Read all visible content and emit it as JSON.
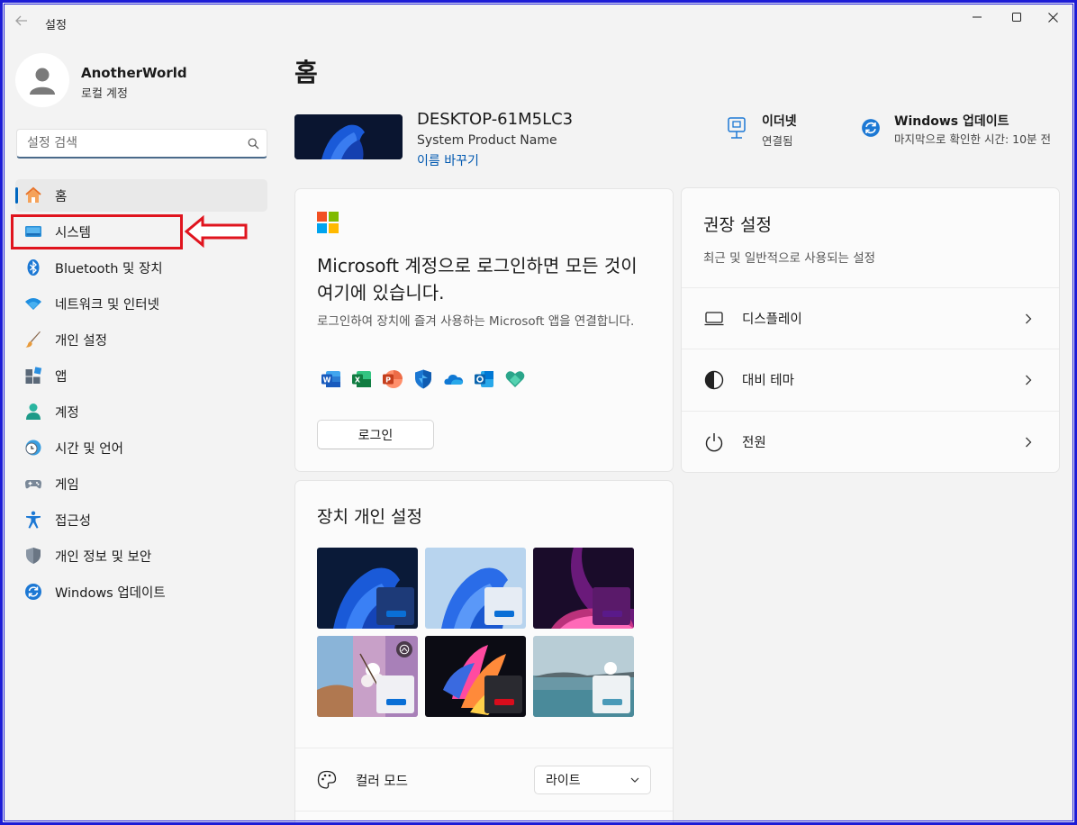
{
  "window": {
    "title": "설정",
    "controls": [
      "minimize",
      "maximize",
      "close"
    ]
  },
  "user": {
    "name": "AnotherWorld",
    "account_type": "로컬 계정"
  },
  "search": {
    "placeholder": "설정 검색",
    "value": ""
  },
  "sidebar": {
    "items": [
      {
        "label": "홈",
        "icon": "home-icon",
        "active": true
      },
      {
        "label": "시스템",
        "icon": "system-icon"
      },
      {
        "label": "Bluetooth 및 장치",
        "icon": "bluetooth-icon"
      },
      {
        "label": "네트워크 및 인터넷",
        "icon": "wifi-icon"
      },
      {
        "label": "개인 설정",
        "icon": "brush-icon"
      },
      {
        "label": "앱",
        "icon": "apps-icon"
      },
      {
        "label": "계정",
        "icon": "account-icon"
      },
      {
        "label": "시간 및 언어",
        "icon": "clock-globe-icon"
      },
      {
        "label": "게임",
        "icon": "gamepad-icon"
      },
      {
        "label": "접근성",
        "icon": "accessibility-icon"
      },
      {
        "label": "개인 정보 및 보안",
        "icon": "shield-icon"
      },
      {
        "label": "Windows 업데이트",
        "icon": "update-icon"
      }
    ]
  },
  "page": {
    "title": "홈"
  },
  "device": {
    "name": "DESKTOP-61M5LC3",
    "model": "System Product Name",
    "rename_label": "이름 바꾸기"
  },
  "status": {
    "ethernet": {
      "title": "이더넷",
      "subtitle": "연결됨"
    },
    "update": {
      "title": "Windows 업데이트",
      "subtitle": "마지막으로 확인한 시간: 10분 전"
    }
  },
  "ms_account_card": {
    "title": "Microsoft 계정으로 로그인하면 모든 것이 여기에 있습니다.",
    "description": "로그인하여 장치에 즐겨 사용하는 Microsoft 앱을 연결합니다.",
    "apps": [
      "word-icon",
      "excel-icon",
      "powerpoint-icon",
      "defender-icon",
      "onedrive-icon",
      "outlook-icon",
      "family-icon"
    ],
    "signin_label": "로그인"
  },
  "recommended": {
    "title": "권장 설정",
    "subtitle": "최근 및 일반적으로 사용되는 설정",
    "items": [
      {
        "label": "디스플레이",
        "icon": "display-icon"
      },
      {
        "label": "대비 테마",
        "icon": "contrast-icon"
      },
      {
        "label": "전원",
        "icon": "power-icon"
      }
    ]
  },
  "personalize": {
    "title": "장치 개인 설정",
    "themes": [
      {
        "name": "windows-dark",
        "accent": "#0a6fd6"
      },
      {
        "name": "windows-light",
        "accent": "#0a6fd6"
      },
      {
        "name": "glow",
        "accent": "#5a1a8a"
      },
      {
        "name": "spotlight",
        "accent": "#0a6fd6"
      },
      {
        "name": "flow",
        "accent": "#d80c1c"
      },
      {
        "name": "sunrise",
        "accent": "#4a9ab8"
      }
    ],
    "color_mode_label": "컬러 모드",
    "color_mode_value": "라이트"
  },
  "colors": {
    "accent": "#0067c0",
    "highlight": "#e0141e",
    "frame": "#1c1cd6"
  }
}
